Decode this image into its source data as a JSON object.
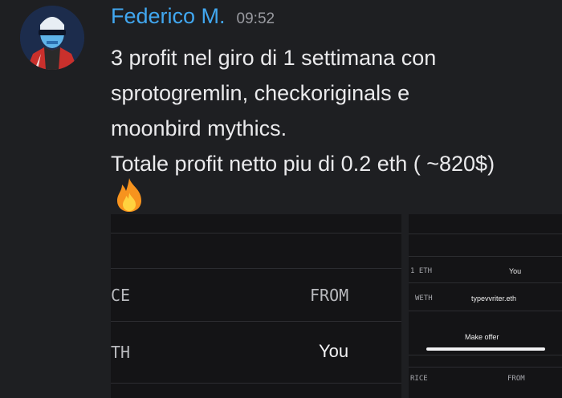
{
  "message": {
    "username": "Federico M.",
    "timestamp": "09:52",
    "lines": [
      "3 profit nel giro di 1 settimana con",
      "sprotogremlin, checkoriginals e",
      "moonbird mythics.",
      "Totale profit netto piu di 0.2 eth ( ~820$)"
    ],
    "emoji": "fire-icon"
  },
  "attachment_left": {
    "col_price": "CE",
    "col_from": "FROM",
    "row_currency": "TH",
    "row_from": "You"
  },
  "attachment_right": {
    "row1_amount": "1 ETH",
    "row1_from": "You",
    "row2_currency": "WETH",
    "row2_from": "typevvriter.eth",
    "button_label": "Make offer",
    "col_price": "RICE",
    "col_from": "FROM"
  },
  "colors": {
    "background": "#1e1f22",
    "username": "#41a7f0",
    "timestamp": "#9a9ba1"
  }
}
